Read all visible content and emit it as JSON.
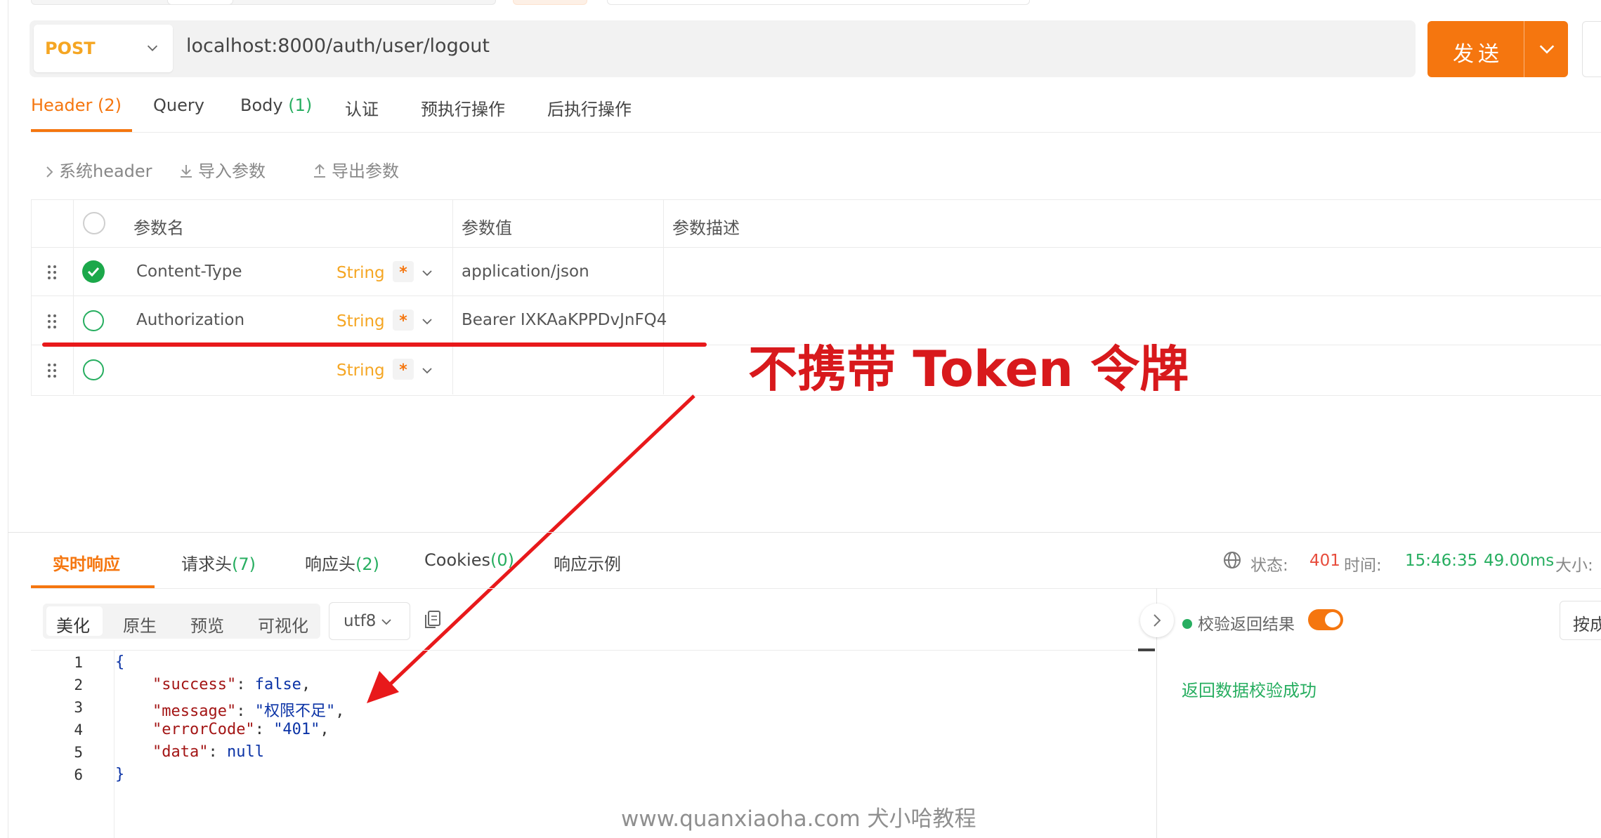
{
  "request": {
    "method": "POST",
    "url": "localhost:8000/auth/user/logout",
    "send_label": "发送"
  },
  "tabs": [
    {
      "label": "Header",
      "count": "(2)",
      "active": true
    },
    {
      "label": "Query",
      "count": ""
    },
    {
      "label": "Body",
      "count": "(1)"
    },
    {
      "label": "认证",
      "count": ""
    },
    {
      "label": "预执行操作",
      "count": ""
    },
    {
      "label": "后执行操作",
      "count": ""
    }
  ],
  "toolbar": {
    "system_header": "系统header",
    "import_params": "导入参数",
    "export_params": "导出参数"
  },
  "table": {
    "headers": {
      "name": "参数名",
      "value": "参数值",
      "desc": "参数描述"
    },
    "rows": [
      {
        "name": "Content-Type",
        "type": "String",
        "required": "*",
        "value": "application/json",
        "checked": true
      },
      {
        "name": "Authorization",
        "type": "String",
        "required": "*",
        "value": "Bearer IXKAaKPPDvJnFQ4",
        "checked": false
      },
      {
        "name": "",
        "type": "String",
        "required": "*",
        "value": "",
        "checked": false
      }
    ]
  },
  "annotation": {
    "text": "不携带 Token 令牌",
    "color": "#d8191c"
  },
  "response": {
    "tabs": [
      {
        "label": "实时响应",
        "count": "",
        "active": true
      },
      {
        "label": "请求头",
        "count": "(7)"
      },
      {
        "label": "响应头",
        "count": "(2)"
      },
      {
        "label": "Cookies",
        "count": "(0)"
      },
      {
        "label": "响应示例",
        "count": ""
      }
    ],
    "status_label": "状态:",
    "status_code": "401",
    "time_label": "时间:",
    "time_value": "15:46:35",
    "duration": "49.00ms",
    "size_label": "大小:",
    "view_modes": [
      "美化",
      "原生",
      "预览",
      "可视化"
    ],
    "encoding": "utf8",
    "code_lines": [
      "1",
      "2",
      "3",
      "4",
      "5",
      "6"
    ],
    "body": {
      "open": "{",
      "success_key": "\"success\"",
      "success_val": "false",
      "message_key": "\"message\"",
      "message_val": "\"权限不足\"",
      "errorcode_key": "\"errorCode\"",
      "errorcode_val": "\"401\"",
      "data_key": "\"data\"",
      "data_val": "null",
      "close": "}"
    },
    "verify_label": "校验返回结果",
    "verify_result": "返回数据校验成功",
    "press_button": "按成"
  },
  "colors": {
    "accent": "#f5760f",
    "success": "#27ae60",
    "error": "#e74c3c",
    "method": "#f5a623"
  },
  "watermark": "www.quanxiaoha.com 犬小哈教程"
}
